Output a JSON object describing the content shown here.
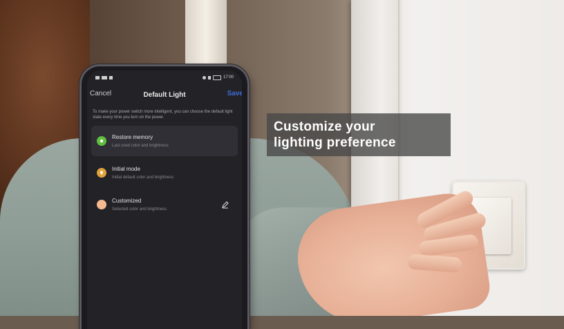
{
  "caption": {
    "line1": "Customize your",
    "line2": "lighting preference"
  },
  "phone": {
    "status_left": "▣▐░ ≡¹¹",
    "status_right": "17:00",
    "nav": {
      "cancel": "Cancel",
      "title": "Default Light",
      "save": "Save"
    },
    "description": "To make your power switch more intelligent, you can choose the default light state every time you turn on the power.",
    "options": [
      {
        "title": "Restore memory",
        "subtitle": "Last used color and brightness",
        "icon": "memory-icon",
        "color": "#5fbf3e",
        "selected": true
      },
      {
        "title": "Initial mode",
        "subtitle": "Initial default color and brightness",
        "icon": "bulb-icon",
        "color": "#e0a23a",
        "selected": false
      },
      {
        "title": "Customized",
        "subtitle": "Selected color and brightness",
        "icon": "color-dot-icon",
        "color": "#f6b88e",
        "selected": false
      }
    ]
  },
  "colors": {
    "save_accent": "#3d6fd8",
    "caption_bg": "#464646",
    "screen_bg": "#232227"
  }
}
